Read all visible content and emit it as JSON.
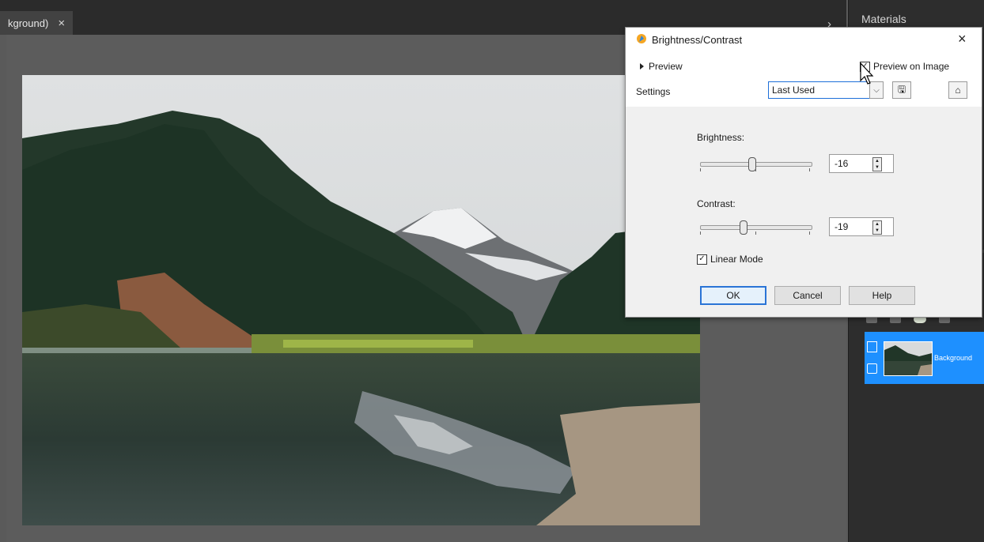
{
  "document_tab": {
    "title": "kground)",
    "close": "×"
  },
  "materials_panel": {
    "title": "Materials"
  },
  "layers": {
    "background_label": "Background"
  },
  "dialog": {
    "title": "Brightness/Contrast",
    "close": "×",
    "preview_label": "Preview",
    "preview_on_image_label": "Preview on Image",
    "preview_on_image_checked": true,
    "settings_label": "Settings",
    "settings_value": "Last Used",
    "brightness_label": "Brightness:",
    "brightness_value": "-16",
    "contrast_label": "Contrast:",
    "contrast_value": "-19",
    "linear_mode_label": "Linear Mode",
    "linear_mode_checked": true,
    "ok_label": "OK",
    "cancel_label": "Cancel",
    "help_label": "Help"
  },
  "colors": {
    "accent": "#1e90ff",
    "dialog_bg": "#f0f0f0",
    "ok_border": "#2a74d6"
  }
}
